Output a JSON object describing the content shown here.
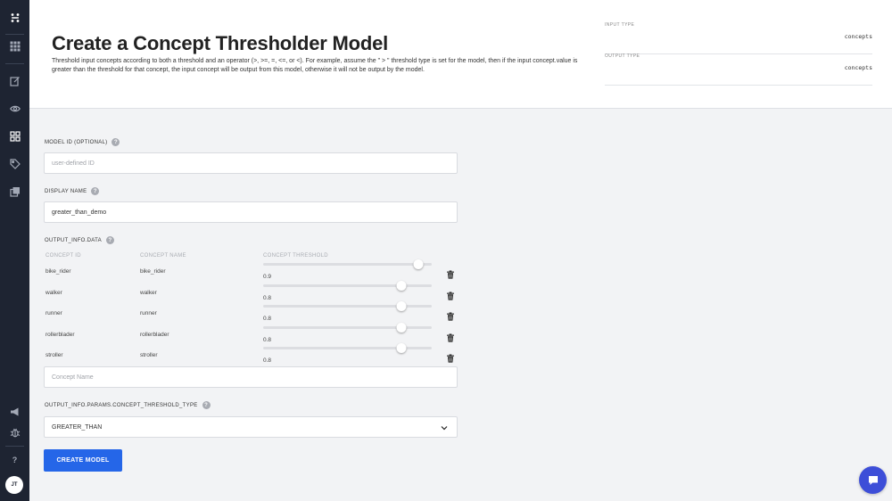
{
  "sidebar": {
    "items": [
      {
        "name": "logo-icon"
      },
      {
        "name": "apps-grid-icon"
      },
      {
        "name": "edit-icon"
      },
      {
        "name": "eye-icon"
      },
      {
        "name": "models-icon"
      },
      {
        "name": "tag-icon"
      },
      {
        "name": "collections-icon"
      },
      {
        "name": "announcement-icon"
      },
      {
        "name": "bug-icon"
      }
    ],
    "help_label": "?",
    "avatar_initials": "JT"
  },
  "header": {
    "title": "Create a Concept Thresholder Model",
    "description": "Threshold input concepts according to both a threshold and an operator (>, >=, =, <=, or <). For example, assume the \" > \" threshold type is set for the model, then if the input concept.value is greater than the threshold for that concept, the input concept will be output from this model, otherwise it will not be output by the model.",
    "input_type_label": "INPUT TYPE",
    "input_type_value": "concepts",
    "output_type_label": "OUTPUT TYPE",
    "output_type_value": "concepts"
  },
  "form": {
    "model_id": {
      "label": "MODEL ID (OPTIONAL)",
      "placeholder": "user-defined ID",
      "value": ""
    },
    "display_name": {
      "label": "DISPLAY NAME",
      "value": "greater_than_demo"
    },
    "output_info_data": {
      "label": "OUTPUT_INFO.DATA",
      "columns": [
        "CONCEPT ID",
        "CONCEPT NAME",
        "CONCEPT THRESHOLD"
      ],
      "rows": [
        {
          "id": "bike_rider",
          "name": "bike_rider",
          "threshold": 0.9,
          "threshold_label": "0.9"
        },
        {
          "id": "walker",
          "name": "walker",
          "threshold": 0.8,
          "threshold_label": "0.8"
        },
        {
          "id": "runner",
          "name": "runner",
          "threshold": 0.8,
          "threshold_label": "0.8"
        },
        {
          "id": "rollerblader",
          "name": "rollerblader",
          "threshold": 0.8,
          "threshold_label": "0.8"
        },
        {
          "id": "stroller",
          "name": "stroller",
          "threshold": 0.8,
          "threshold_label": "0.8"
        }
      ],
      "concept_name_placeholder": "Concept Name"
    },
    "threshold_type": {
      "label": "OUTPUT_INFO.PARAMS.CONCEPT_THRESHOLD_TYPE",
      "value": "GREATER_THAN"
    },
    "submit_label": "CREATE MODEL",
    "help_icon_glyph": "?"
  },
  "colors": {
    "sidebar_bg": "#1e2432",
    "accent": "#2566e8",
    "chat_bubble": "#3d4ed8",
    "page_bg": "#f2f3f5"
  }
}
